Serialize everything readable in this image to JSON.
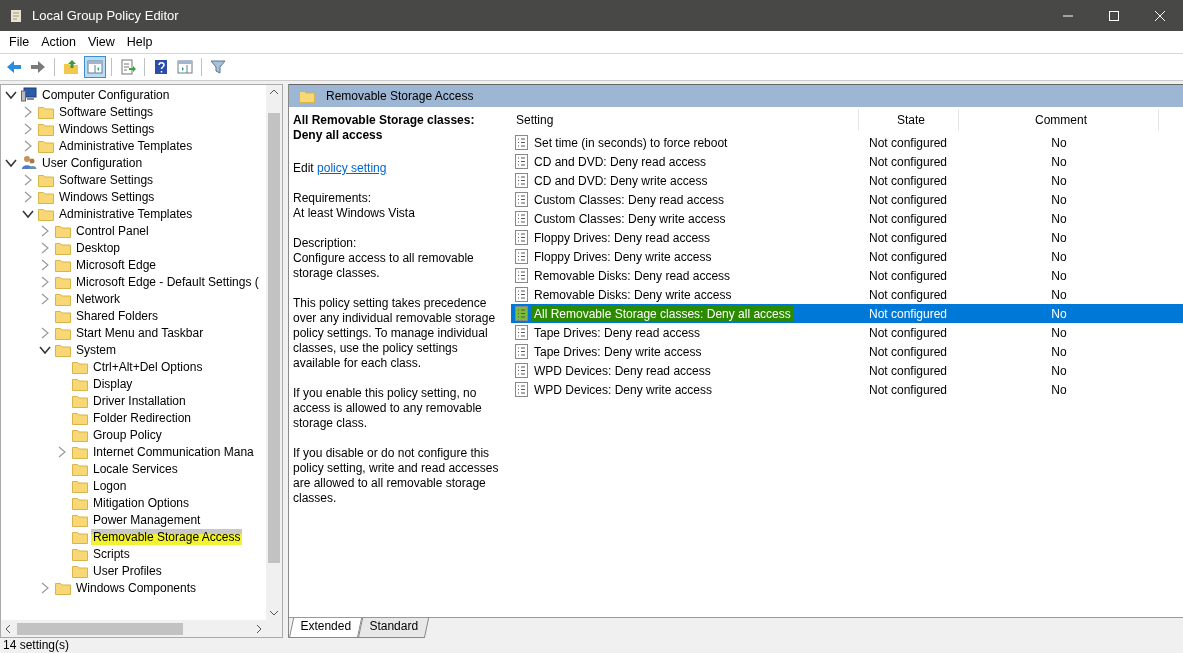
{
  "window": {
    "title": "Local Group Policy Editor"
  },
  "menu": [
    "File",
    "Action",
    "View",
    "Help"
  ],
  "toolbar": [
    [
      {
        "kind": "back",
        "pressed": false
      },
      {
        "kind": "forward",
        "pressed": false
      }
    ],
    [
      {
        "kind": "up",
        "pressed": false
      },
      {
        "kind": "tree",
        "pressed": true
      }
    ],
    [
      {
        "kind": "export",
        "pressed": false
      }
    ],
    [
      {
        "kind": "help",
        "pressed": false
      },
      {
        "kind": "pane",
        "pressed": false
      }
    ],
    [
      {
        "kind": "filter",
        "pressed": false
      }
    ]
  ],
  "tree": [
    {
      "label": "Computer Configuration",
      "kind": "computer",
      "expandable": true,
      "expanded": true,
      "selected": false,
      "marked": false,
      "children": [
        {
          "label": "Software Settings",
          "kind": "folder",
          "expandable": true,
          "expanded": false,
          "selected": false,
          "marked": false
        },
        {
          "label": "Windows Settings",
          "kind": "folder",
          "expandable": true,
          "expanded": false,
          "selected": false,
          "marked": false
        },
        {
          "label": "Administrative Templates",
          "kind": "folder",
          "expandable": true,
          "expanded": false,
          "selected": false,
          "marked": false
        }
      ]
    },
    {
      "label": "User Configuration",
      "kind": "user",
      "expandable": true,
      "expanded": true,
      "selected": false,
      "marked": false,
      "children": [
        {
          "label": "Software Settings",
          "kind": "folder",
          "expandable": true,
          "expanded": false,
          "selected": false,
          "marked": false
        },
        {
          "label": "Windows Settings",
          "kind": "folder",
          "expandable": true,
          "expanded": false,
          "selected": false,
          "marked": false
        },
        {
          "label": "Administrative Templates",
          "kind": "folder",
          "expandable": true,
          "expanded": true,
          "selected": false,
          "marked": false,
          "children": [
            {
              "label": "Control Panel",
              "kind": "folder",
              "expandable": true,
              "expanded": false,
              "selected": false,
              "marked": false
            },
            {
              "label": "Desktop",
              "kind": "folder",
              "expandable": true,
              "expanded": false,
              "selected": false,
              "marked": false
            },
            {
              "label": "Microsoft Edge",
              "kind": "folder",
              "expandable": true,
              "expanded": false,
              "selected": false,
              "marked": false
            },
            {
              "label": "Microsoft Edge - Default Settings (",
              "kind": "folder",
              "expandable": true,
              "expanded": false,
              "selected": false,
              "marked": false
            },
            {
              "label": "Network",
              "kind": "folder",
              "expandable": true,
              "expanded": false,
              "selected": false,
              "marked": false
            },
            {
              "label": "Shared Folders",
              "kind": "folder",
              "expandable": false,
              "selected": false,
              "marked": false
            },
            {
              "label": "Start Menu and Taskbar",
              "kind": "folder",
              "expandable": true,
              "expanded": false,
              "selected": false,
              "marked": false
            },
            {
              "label": "System",
              "kind": "folder",
              "expandable": true,
              "expanded": true,
              "selected": false,
              "marked": false,
              "children": [
                {
                  "label": "Ctrl+Alt+Del Options",
                  "kind": "folder",
                  "expandable": false,
                  "selected": false,
                  "marked": false
                },
                {
                  "label": "Display",
                  "kind": "folder",
                  "expandable": false,
                  "selected": false,
                  "marked": false
                },
                {
                  "label": "Driver Installation",
                  "kind": "folder",
                  "expandable": false,
                  "selected": false,
                  "marked": false
                },
                {
                  "label": "Folder Redirection",
                  "kind": "folder",
                  "expandable": false,
                  "selected": false,
                  "marked": false
                },
                {
                  "label": "Group Policy",
                  "kind": "folder",
                  "expandable": false,
                  "selected": false,
                  "marked": false
                },
                {
                  "label": "Internet Communication Mana",
                  "kind": "folder",
                  "expandable": true,
                  "expanded": false,
                  "selected": false,
                  "marked": false
                },
                {
                  "label": "Locale Services",
                  "kind": "folder",
                  "expandable": false,
                  "selected": false,
                  "marked": false
                },
                {
                  "label": "Logon",
                  "kind": "folder",
                  "expandable": false,
                  "selected": false,
                  "marked": false
                },
                {
                  "label": "Mitigation Options",
                  "kind": "folder",
                  "expandable": false,
                  "selected": false,
                  "marked": false
                },
                {
                  "label": "Power Management",
                  "kind": "folder",
                  "expandable": false,
                  "selected": false,
                  "marked": false
                },
                {
                  "label": "Removable Storage Access",
                  "kind": "folder",
                  "expandable": false,
                  "selected": true,
                  "marked": true
                },
                {
                  "label": "Scripts",
                  "kind": "folder",
                  "expandable": false,
                  "selected": false,
                  "marked": false
                },
                {
                  "label": "User Profiles",
                  "kind": "folder",
                  "expandable": false,
                  "selected": false,
                  "marked": false
                }
              ]
            },
            {
              "label": "Windows Components",
              "kind": "folder",
              "expandable": true,
              "expanded": false,
              "selected": false,
              "marked": false
            }
          ]
        }
      ]
    }
  ],
  "header": {
    "title": "Removable Storage Access"
  },
  "detail": {
    "title": "All Removable Storage classes: Deny all access",
    "edit_label": "Edit",
    "edit_link": "policy setting",
    "paragraphs": [
      "Requirements:\nAt least Windows Vista",
      "Description:\nConfigure access to all removable storage classes.",
      "This policy setting takes precedence over any individual removable storage policy settings. To manage individual classes, use the policy settings available for each class.",
      "If you enable this policy setting, no access is allowed to any removable storage class.",
      "If you disable or do not configure this policy setting, write and read accesses are allowed to all removable storage classes."
    ]
  },
  "table": {
    "columns": [
      "Setting",
      "State",
      "Comment"
    ],
    "rows": [
      {
        "name": "Set time (in seconds) to force reboot",
        "state": "Not configured",
        "comment": "No",
        "selected": false,
        "marked": false
      },
      {
        "name": "CD and DVD: Deny read access",
        "state": "Not configured",
        "comment": "No",
        "selected": false,
        "marked": false
      },
      {
        "name": "CD and DVD: Deny write access",
        "state": "Not configured",
        "comment": "No",
        "selected": false,
        "marked": false
      },
      {
        "name": "Custom Classes: Deny read access",
        "state": "Not configured",
        "comment": "No",
        "selected": false,
        "marked": false
      },
      {
        "name": "Custom Classes: Deny write access",
        "state": "Not configured",
        "comment": "No",
        "selected": false,
        "marked": false
      },
      {
        "name": "Floppy Drives: Deny read access",
        "state": "Not configured",
        "comment": "No",
        "selected": false,
        "marked": false
      },
      {
        "name": "Floppy Drives: Deny write access",
        "state": "Not configured",
        "comment": "No",
        "selected": false,
        "marked": false
      },
      {
        "name": "Removable Disks: Deny read access",
        "state": "Not configured",
        "comment": "No",
        "selected": false,
        "marked": false
      },
      {
        "name": "Removable Disks: Deny write access",
        "state": "Not configured",
        "comment": "No",
        "selected": false,
        "marked": false
      },
      {
        "name": "All Removable Storage classes: Deny all access",
        "state": "Not configured",
        "comment": "No",
        "selected": true,
        "marked": true
      },
      {
        "name": "Tape Drives: Deny read access",
        "state": "Not configured",
        "comment": "No",
        "selected": false,
        "marked": false
      },
      {
        "name": "Tape Drives: Deny write access",
        "state": "Not configured",
        "comment": "No",
        "selected": false,
        "marked": false
      },
      {
        "name": "WPD Devices: Deny read access",
        "state": "Not configured",
        "comment": "No",
        "selected": false,
        "marked": false
      },
      {
        "name": "WPD Devices: Deny write access",
        "state": "Not configured",
        "comment": "No",
        "selected": false,
        "marked": false
      }
    ]
  },
  "tabs": [
    {
      "label": "Extended",
      "selected": true
    },
    {
      "label": "Standard",
      "selected": false
    }
  ],
  "status_bar": {
    "text": "14 setting(s)"
  }
}
